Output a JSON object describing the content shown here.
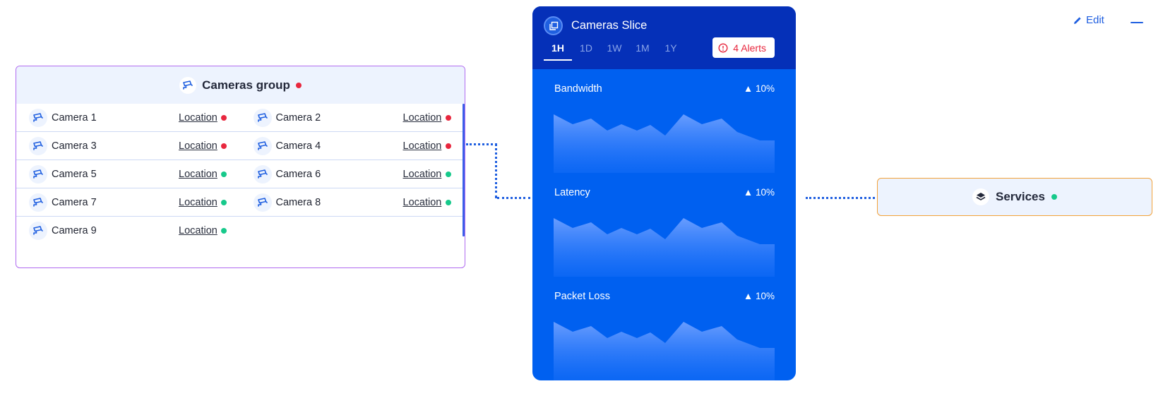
{
  "toolbar": {
    "edit_label": "Edit"
  },
  "cameras_group": {
    "title": "Cameras group",
    "status_color": "#e8273e",
    "rows": [
      [
        {
          "name": "Camera 1",
          "location": "Location",
          "status": "red"
        },
        {
          "name": "Camera 2",
          "location": "Location",
          "status": "red"
        }
      ],
      [
        {
          "name": "Camera 3",
          "location": "Location",
          "status": "red"
        },
        {
          "name": "Camera 4",
          "location": "Location",
          "status": "red"
        }
      ],
      [
        {
          "name": "Camera 5",
          "location": "Location",
          "status": "green"
        },
        {
          "name": "Camera 6",
          "location": "Location",
          "status": "green"
        }
      ],
      [
        {
          "name": "Camera 7",
          "location": "Location",
          "status": "green"
        },
        {
          "name": "Camera 8",
          "location": "Location",
          "status": "green"
        }
      ],
      [
        {
          "name": "Camera 9",
          "location": "Location",
          "status": "green"
        }
      ]
    ]
  },
  "slice": {
    "title": "Cameras Slice",
    "tabs": [
      "1H",
      "1D",
      "1W",
      "1M",
      "1Y"
    ],
    "active_tab": "1H",
    "alerts_label": "4 Alerts",
    "metrics": [
      {
        "label": "Bandwidth",
        "delta": "▲ 10%"
      },
      {
        "label": "Latency",
        "delta": "▲ 10%"
      },
      {
        "label": "Packet Loss",
        "delta": "▲ 10%"
      }
    ]
  },
  "services": {
    "title": "Services",
    "status": "green"
  },
  "colors": {
    "accent": "#1f5fe0",
    "slice_bg": "#0060f0",
    "slice_header_bg": "#0530b8",
    "status_red": "#e8273e",
    "status_green": "#17c98b",
    "group_border": "#b06af0",
    "services_border": "#f2a23a"
  },
  "icons": {
    "camera": "cctv-camera-icon",
    "slice": "copy-stack-icon",
    "alerts": "alert-circle-icon",
    "services": "layers-icon",
    "edit": "pencil-icon",
    "minimize": "minimize-icon"
  }
}
